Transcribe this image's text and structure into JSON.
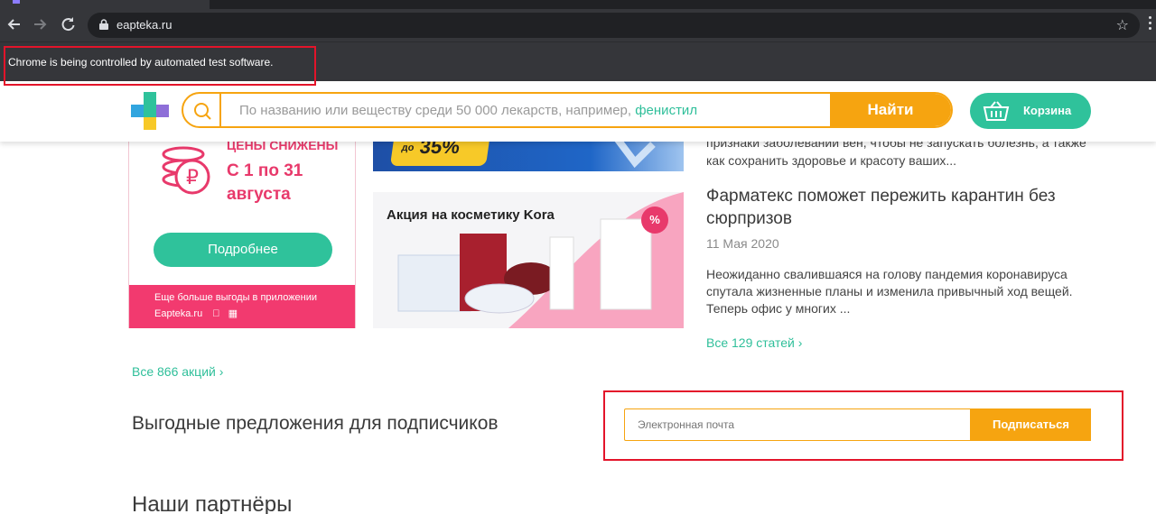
{
  "browser": {
    "url": "eapteka.ru",
    "infobar_text": "Chrome is being controlled by automated test software."
  },
  "header": {
    "search_placeholder": "По названию или веществу среди 50 000 лекарств, например,",
    "search_example": "фенистил",
    "search_button": "Найти",
    "cart_label": "Корзина"
  },
  "promo": {
    "price_text": "ЦЕНЫ СНИЖЕНЫ",
    "dates": "С 1 по 31 августа",
    "more_button": "Подробнее",
    "app_text": "Еще больше выгоды в приложении",
    "app_site": "Eapteka.ru"
  },
  "banners": {
    "sale_prefix": "до",
    "sale_value": "35%",
    "kora_title": "Акция на косметику Kora",
    "kora_badge": "%"
  },
  "promotions_link": "Все 866 акций",
  "article": {
    "prev_snippet": "признаки заболеваний вен, чтобы не запускать болезнь, а также как сохранить здоровье и красоту ваших...",
    "title": "Фарматекс поможет пережить карантин без сюрпризов",
    "date": "11 Мая 2020",
    "body": "Неожиданно свалившаяся на голову пандемия коронавируса спутала жизненные планы и изменила привычный ход вещей. Теперь офис у многих ...",
    "all_link": "Все 129 статей"
  },
  "subscribe": {
    "title": "Выгодные предложения для подписчиков",
    "email_placeholder": "Электронная почта",
    "button": "Подписаться"
  },
  "partners_title": "Наши партнёры",
  "colors": {
    "accent_orange": "#f6a410",
    "accent_green": "#2fc29b",
    "accent_pink": "#e8396b",
    "highlight_red": "#e3142a"
  }
}
